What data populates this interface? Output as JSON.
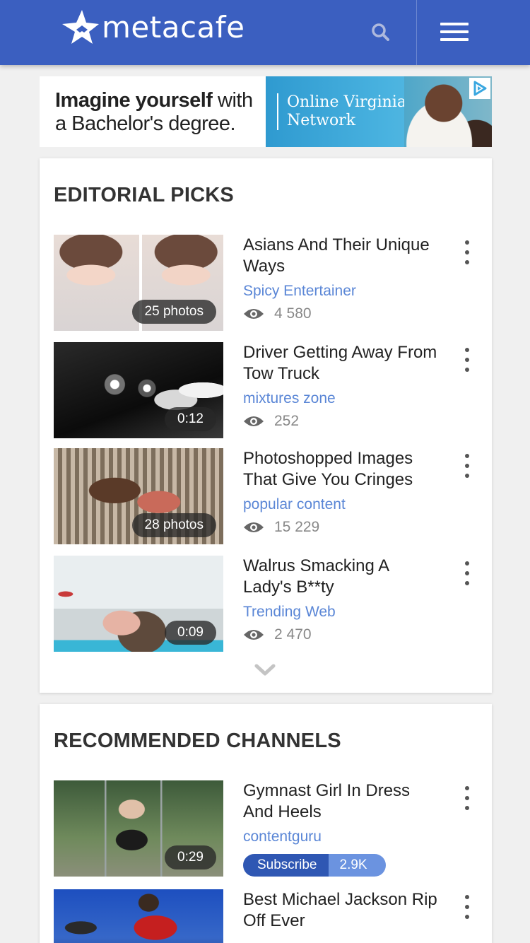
{
  "header": {
    "brand": "metacafe",
    "colors": {
      "bar": "#3b5fc0"
    }
  },
  "ad": {
    "headline_bold": "Imagine yourself",
    "headline_rest": " with",
    "subline": "a Bachelor's degree.",
    "brand_line1": "Online Virginia",
    "brand_line2": "Network"
  },
  "editorial": {
    "title": "EDITORIAL PICKS",
    "items": [
      {
        "title": "Asians And Their Unique Ways",
        "channel": "Spicy Entertainer",
        "views": "4 580",
        "badge": "25 photos"
      },
      {
        "title": "Driver Getting Away From Tow Truck",
        "channel": "mixtures zone",
        "views": "252",
        "badge": "0:12"
      },
      {
        "title": "Photoshopped Images That Give You Cringes",
        "channel": "popular content",
        "views": "15 229",
        "badge": "28 photos"
      },
      {
        "title": "Walrus Smacking A Lady's B**ty",
        "channel": "Trending Web",
        "views": "2 470",
        "badge": "0:09"
      }
    ]
  },
  "recommended": {
    "title": "RECOMMENDED CHANNELS",
    "items": [
      {
        "title": "Gymnast Girl In Dress And Heels",
        "channel": "contentguru",
        "badge": "0:29",
        "subscribe_label": "Subscribe",
        "subscribe_count": "2.9K"
      },
      {
        "title": "Best Michael Jackson Rip Off Ever"
      }
    ]
  }
}
